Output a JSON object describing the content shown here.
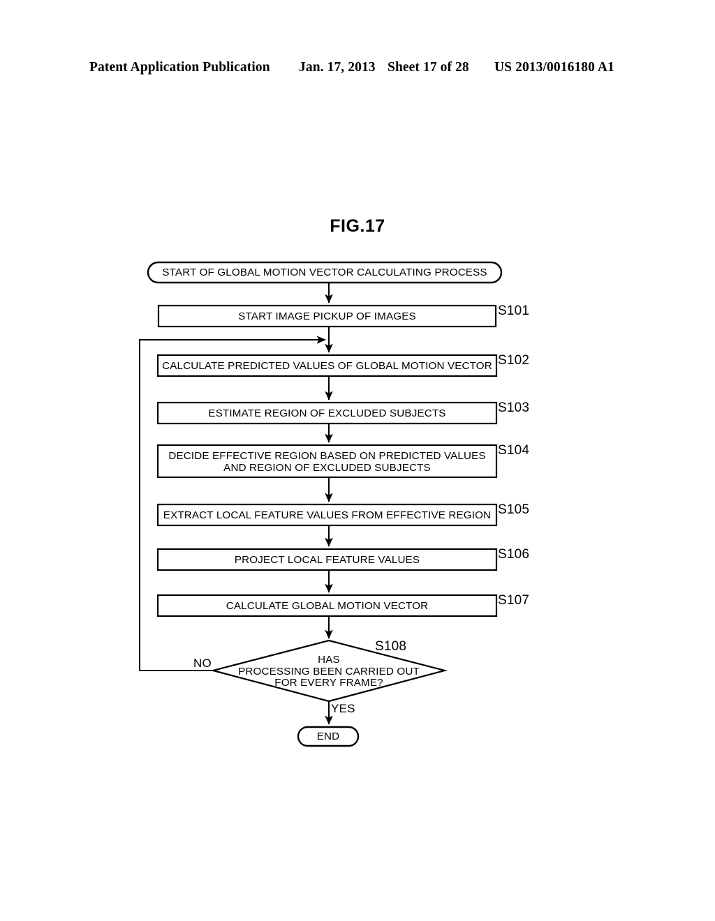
{
  "header": {
    "publication": "Patent Application Publication",
    "date": "Jan. 17, 2013",
    "sheet": "Sheet 17 of 28",
    "patent_number": "US 2013/0016180 A1"
  },
  "figure": {
    "title": "FIG.17"
  },
  "flowchart": {
    "type": "flowchart",
    "start": {
      "shape": "rounded-terminal",
      "label": "START OF GLOBAL MOTION VECTOR CALCULATING PROCESS"
    },
    "steps": [
      {
        "id": "S101",
        "shape": "process",
        "label": "START IMAGE PICKUP OF IMAGES"
      },
      {
        "id": "S102",
        "shape": "process",
        "label": "CALCULATE PREDICTED VALUES OF GLOBAL MOTION VECTOR"
      },
      {
        "id": "S103",
        "shape": "process",
        "label": "ESTIMATE REGION OF EXCLUDED SUBJECTS"
      },
      {
        "id": "S104",
        "shape": "process",
        "label": "DECIDE EFFECTIVE REGION BASED ON PREDICTED VALUES\nAND REGION OF EXCLUDED SUBJECTS"
      },
      {
        "id": "S105",
        "shape": "process",
        "label": "EXTRACT LOCAL FEATURE VALUES FROM EFFECTIVE REGION"
      },
      {
        "id": "S106",
        "shape": "process",
        "label": "PROJECT LOCAL FEATURE VALUES"
      },
      {
        "id": "S107",
        "shape": "process",
        "label": "CALCULATE GLOBAL MOTION VECTOR"
      }
    ],
    "decision": {
      "id": "S108",
      "shape": "diamond",
      "label": "HAS\nPROCESSING BEEN CARRIED OUT\nFOR EVERY FRAME?",
      "no_label": "NO",
      "yes_label": "YES"
    },
    "end": {
      "shape": "rounded-terminal",
      "label": "END"
    },
    "loop_note": "NO branch returns to step S102 input"
  }
}
